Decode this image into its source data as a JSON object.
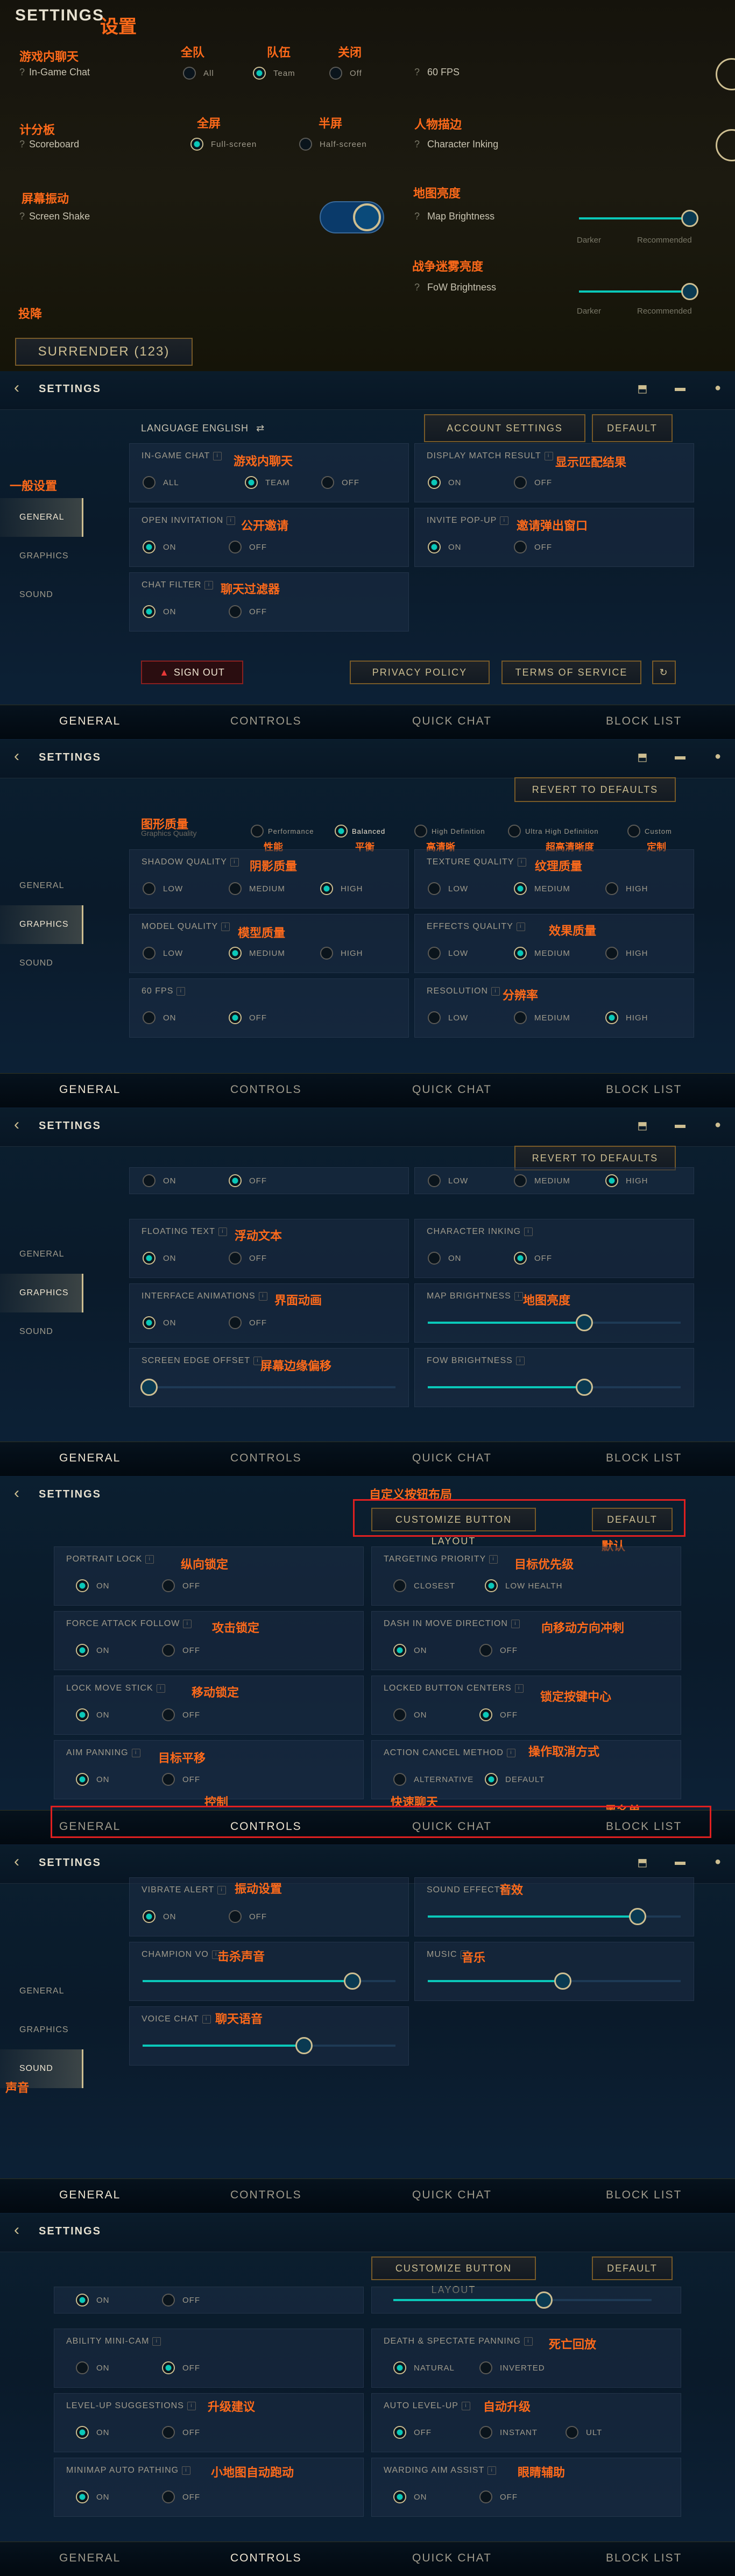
{
  "annotations": {
    "settings_cn": "设置",
    "ingame_chat_cn": "游戏内聊天",
    "all_team_cn": "全队",
    "team_cn": "队伍",
    "off_cn": "关闭",
    "scoreboard_cn": "计分板",
    "fullscreen_cn": "全屏",
    "halfscreen_cn": "半屏",
    "char_ink_cn": "人物描边",
    "screen_shake_cn": "屏幕振动",
    "map_brightness_cn": "地图亮度",
    "fow_cn": "战争迷雾亮度",
    "surrender_cn": "投降",
    "general_cn": "一般设置",
    "ingame_chat2_cn": "游戏内聊天",
    "display_match_cn": "显示匹配结果",
    "open_invite_cn": "公开邀请",
    "invite_popup_cn": "邀请弹出窗口",
    "chat_filter_cn": "聊天过滤器",
    "graphics_quality_cn": "图形质量",
    "performance_cn": "性能",
    "balanced_cn": "平衡",
    "high_def_cn": "高清晰",
    "ultra_cn": "超高清晰度",
    "custom_cn": "定制",
    "shadow_cn": "阴影质量",
    "texture_cn": "纹理质量",
    "model_cn": "模型质量",
    "effects_cn": "效果质量",
    "resolution_cn": "分辨率",
    "floating_text_cn": "浮动文本",
    "iface_anim_cn": "界面动画",
    "map_bright2_cn": "地图亮度",
    "edge_offset_cn": "屏幕边缘偏移",
    "custom_layout_cn": "自定义按钮布局",
    "default_cn": "默认",
    "portrait_lock_cn": "纵向锁定",
    "targeting_cn": "目标优先级",
    "force_attack_cn": "攻击锁定",
    "dash_move_cn": "向移动方向冲刺",
    "lock_move_cn": "移动锁定",
    "locked_btn_cn": "锁定按键中心",
    "aim_pan_cn": "目标平移",
    "action_cancel_cn": "操作取消方式",
    "general_tab_cn": "一般",
    "controls_cn": "控制",
    "quick_chat_cn": "快速聊天",
    "block_list_cn": "黑名单",
    "vibrate_cn": "振动设置",
    "sound_fx_cn": "音效",
    "champ_vo_cn": "击杀声音",
    "music_cn": "音乐",
    "voice_chat_cn": "聊天语音",
    "sound_cn": "声音",
    "ability_cam_cn": "",
    "death_pan_cn": "死亡回放",
    "levelup_cn": "升级建议",
    "auto_level_cn": "自动升级",
    "minimap_path_cn": "小地图自动跑动",
    "ward_aim_cn": "眼睛辅助"
  },
  "ingame": {
    "title": "SETTINGS",
    "chat_label": "In-Game Chat",
    "all": "All",
    "team": "Team",
    "off": "Off",
    "fps": "60 FPS",
    "scoreboard_label": "Scoreboard",
    "fullscreen": "Full-screen",
    "halfscreen": "Half-screen",
    "char_ink_label": "Character Inking",
    "screen_shake_label": "Screen Shake",
    "map_brightness_label": "Map Brightness",
    "darker": "Darker",
    "recommended": "Recommended",
    "fow_label": "FoW Brightness",
    "surrender": "SURRENDER (123)"
  },
  "common": {
    "settings": "SETTINGS",
    "general": "GENERAL",
    "graphics": "GRAPHICS",
    "sound": "SOUND",
    "controls": "CONTROLS",
    "quick_chat": "QUICK CHAT",
    "block_list": "BLOCK LIST",
    "on": "ON",
    "off": "OFF",
    "all": "ALL",
    "team": "TEAM",
    "low": "LOW",
    "medium": "MEDIUM",
    "high": "HIGH",
    "default": "DEFAULT",
    "revert": "REVERT TO DEFAULTS",
    "customize": "CUSTOMIZE BUTTON LAYOUT"
  },
  "general": {
    "language": "LANGUAGE ENGLISH",
    "account_settings": "ACCOUNT SETTINGS",
    "ingame_chat": "IN-GAME CHAT",
    "display_match": "DISPLAY MATCH RESULT",
    "open_invitation": "OPEN INVITATION",
    "invite_popup": "INVITE POP-UP",
    "chat_filter": "CHAT FILTER",
    "sign_out": "SIGN OUT",
    "privacy": "PRIVACY POLICY",
    "terms": "TERMS OF SERVICE"
  },
  "graphics": {
    "quality_label": "Graphics Quality",
    "performance": "Performance",
    "balanced": "Balanced",
    "high_def": "High Definition",
    "ultra": "Ultra High Definition",
    "custom": "Custom",
    "shadow": "SHADOW QUALITY",
    "texture": "TEXTURE QUALITY",
    "model": "MODEL QUALITY",
    "effects": "EFFECTS QUALITY",
    "fps60": "60 FPS",
    "resolution": "RESOLUTION",
    "floating_text": "FLOATING TEXT",
    "char_inking": "CHARACTER INKING",
    "iface_anim": "INTERFACE ANIMATIONS",
    "map_bright": "MAP BRIGHTNESS",
    "edge_offset": "SCREEN EDGE OFFSET",
    "fow_bright": "FOW BRIGHTNESS"
  },
  "controls": {
    "portrait_lock": "PORTRAIT LOCK",
    "targeting": "TARGETING PRIORITY",
    "closest": "CLOSEST",
    "low_health": "LOW HEALTH",
    "force_attack": "FORCE ATTACK FOLLOW",
    "dash_move": "DASH IN MOVE DIRECTION",
    "lock_move": "LOCK MOVE STICK",
    "locked_btn": "LOCKED BUTTON CENTERS",
    "aim_pan": "AIM PANNING",
    "action_cancel": "ACTION CANCEL METHOD",
    "alternative": "ALTERNATIVE",
    "default_opt": "DEFAULT",
    "ability_cam": "ABILITY MINI-CAM",
    "death_pan": "DEATH & SPECTATE PANNING",
    "natural": "NATURAL",
    "inverted": "INVERTED",
    "levelup": "LEVEL-UP SUGGESTIONS",
    "auto_level": "AUTO LEVEL-UP",
    "instant": "INSTANT",
    "ult": "ULT",
    "minimap_path": "MINIMAP AUTO PATHING",
    "ward_aim": "WARDING AIM ASSIST"
  },
  "sound": {
    "vibrate": "VIBRATE ALERT",
    "sound_fx": "SOUND EFFECTS",
    "champ_vo": "CHAMPION VO",
    "music": "MUSIC",
    "voice_chat": "VOICE CHAT"
  },
  "colors": {
    "accent": "#0ac8b9",
    "gold": "#cdbe91",
    "annotation": "#ff6a1a"
  }
}
